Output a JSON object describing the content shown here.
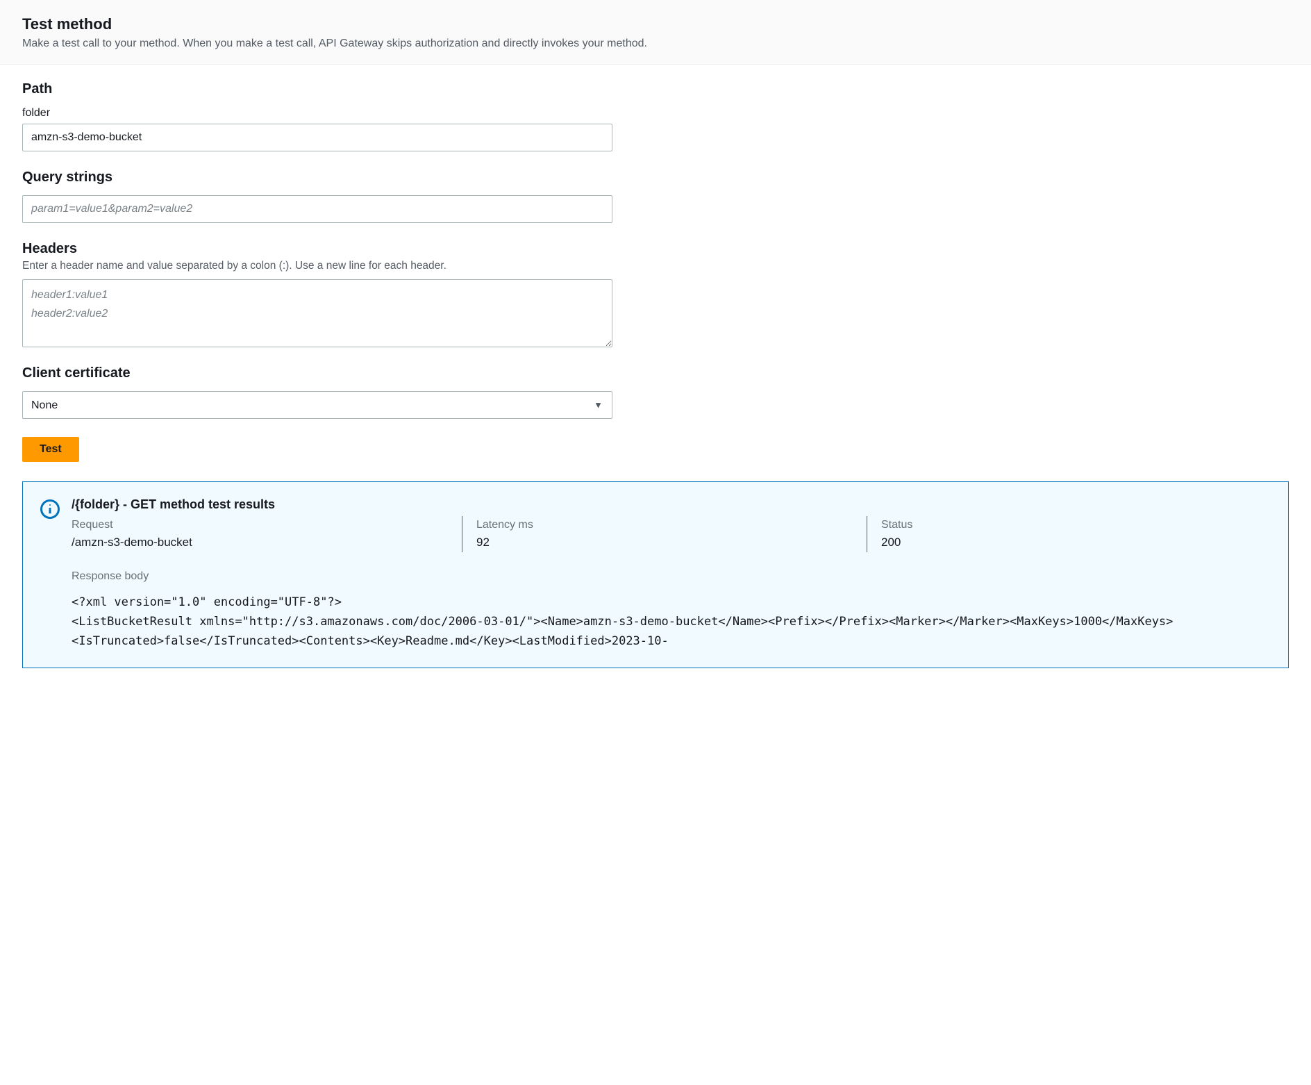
{
  "header": {
    "title": "Test method",
    "description": "Make a test call to your method. When you make a test call, API Gateway skips authorization and directly invokes your method."
  },
  "path": {
    "section_title": "Path",
    "folder_label": "folder",
    "folder_value": "amzn-s3-demo-bucket"
  },
  "query_strings": {
    "section_title": "Query strings",
    "placeholder": "param1=value1&param2=value2",
    "value": ""
  },
  "headers": {
    "section_title": "Headers",
    "sublabel": "Enter a header name and value separated by a colon (:). Use a new line for each header.",
    "placeholder": "header1:value1\nheader2:value2",
    "value": ""
  },
  "client_certificate": {
    "section_title": "Client certificate",
    "selected": "None"
  },
  "actions": {
    "test_label": "Test"
  },
  "results": {
    "title": "/{folder} - GET method test results",
    "request_label": "Request",
    "request_value": "/amzn-s3-demo-bucket",
    "latency_label": "Latency ms",
    "latency_value": "92",
    "status_label": "Status",
    "status_value": "200",
    "response_body_label": "Response body",
    "response_body": "<?xml version=\"1.0\" encoding=\"UTF-8\"?>\n<ListBucketResult xmlns=\"http://s3.amazonaws.com/doc/2006-03-01/\"><Name>amzn-s3-demo-bucket</Name><Prefix></Prefix><Marker></Marker><MaxKeys>1000</MaxKeys><IsTruncated>false</IsTruncated><Contents><Key>Readme.md</Key><LastModified>2023-10-"
  }
}
